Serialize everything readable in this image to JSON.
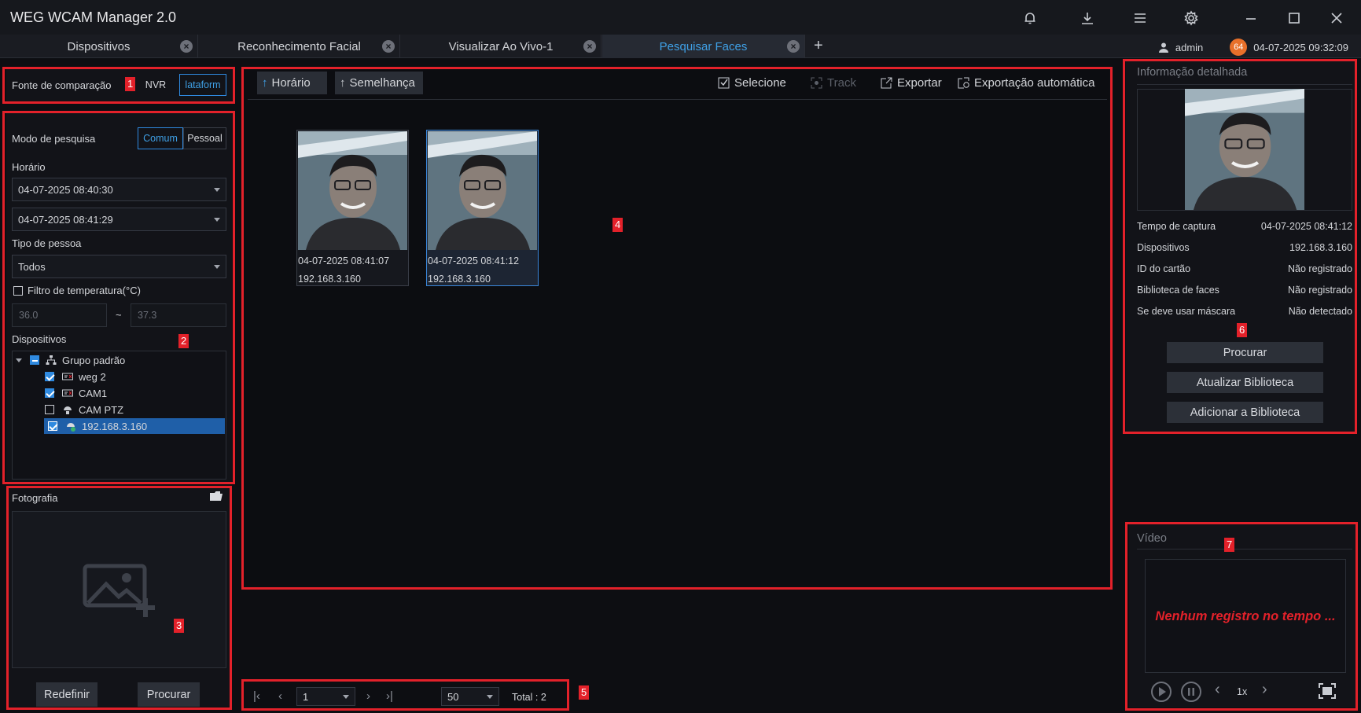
{
  "app": {
    "title": "WEG WCAM Manager 2.0"
  },
  "titlebar_icons": [
    "bell-icon",
    "download-icon",
    "menu-icon",
    "gear-icon",
    "minimize-icon",
    "maximize-icon",
    "close-icon"
  ],
  "tabs": [
    {
      "label": "Dispositivos",
      "active": false
    },
    {
      "label": "Reconhecimento Facial",
      "active": false
    },
    {
      "label": "Visualizar Ao Vivo-1",
      "active": false
    },
    {
      "label": "Pesquisar Faces",
      "active": true
    }
  ],
  "user": {
    "name": "admin",
    "badge": "64",
    "datetime": "04-07-2025 09:32:09"
  },
  "annotations": [
    "1",
    "2",
    "3",
    "4",
    "5",
    "6",
    "7"
  ],
  "comparison": {
    "label": "Fonte de comparação",
    "options": [
      "NVR",
      "lataform"
    ],
    "selected": "lataform"
  },
  "search": {
    "mode_label": "Modo de pesquisa",
    "modes": [
      "Comum",
      "Pessoal"
    ],
    "mode_selected": "Comum",
    "time_label": "Horário",
    "start_time": "04-07-2025 08:40:30",
    "end_time": "04-07-2025 08:41:29",
    "person_type_label": "Tipo de pessoa",
    "person_type": "Todos",
    "temp_filter_label": "Filtro de temperatura(°C)",
    "temp_min": "36.0",
    "temp_sep": "~",
    "temp_max": "37.3",
    "devices_label": "Dispositivos",
    "tree": {
      "group": "Grupo padrão",
      "devices": [
        {
          "name": "weg 2",
          "checked": true,
          "selected": false
        },
        {
          "name": "CAM1",
          "checked": true,
          "selected": false
        },
        {
          "name": "CAM PTZ",
          "checked": false,
          "selected": false
        },
        {
          "name": "192.168.3.160",
          "checked": true,
          "selected": true
        }
      ]
    }
  },
  "photo": {
    "label": "Fotografia",
    "reset_label": "Redefinir",
    "search_label": "Procurar"
  },
  "results_toolbar": {
    "sort_time": "Horário",
    "sort_similarity": "Semelhança",
    "select": "Selecione",
    "track": "Track",
    "export": "Exportar",
    "auto_export": "Exportação automática"
  },
  "results": [
    {
      "time": "04-07-2025 08:41:07",
      "ip": "192.168.3.160",
      "selected": false
    },
    {
      "time": "04-07-2025 08:41:12",
      "ip": "192.168.3.160",
      "selected": true
    }
  ],
  "pager": {
    "page": "1",
    "page_size": "50",
    "total": "Total : 2"
  },
  "detail": {
    "title": "Informação detalhada",
    "rows": [
      {
        "label": "Tempo de captura",
        "value": "04-07-2025 08:41:12"
      },
      {
        "label": "Dispositivos",
        "value": "192.168.3.160"
      },
      {
        "label": "ID do cartão",
        "value": "Não registrado"
      },
      {
        "label": "Biblioteca de faces",
        "value": "Não registrado"
      },
      {
        "label": "Se deve usar máscara",
        "value": "Não detectado"
      }
    ],
    "buttons": [
      "Procurar",
      "Atualizar Biblioteca",
      "Adicionar a Biblioteca"
    ]
  },
  "video": {
    "title": "Vídeo",
    "message": "Nenhum registro no tempo ...",
    "speed": "1x"
  },
  "colors": {
    "accent": "#3fa0e6",
    "annotation": "#e3212a",
    "selection": "#1f5fa8",
    "video_message": "#e3212a"
  }
}
